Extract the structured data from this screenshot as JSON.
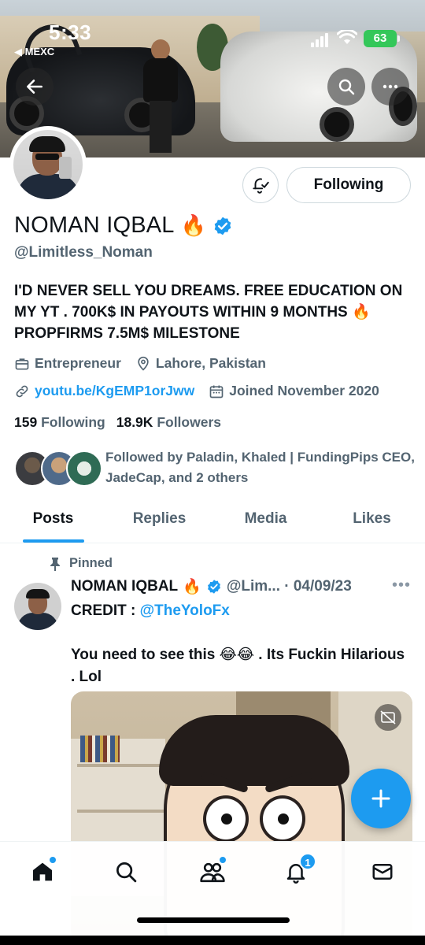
{
  "status_bar": {
    "time": "5:33",
    "back_app": "◀ MEXC",
    "battery": "63"
  },
  "header": {
    "back_icon": "back-arrow-icon",
    "search_icon": "search-icon",
    "more_icon": "more-horizontal-icon"
  },
  "profile": {
    "name": "NOMAN IQBAL",
    "name_emoji": "🔥",
    "verified": true,
    "handle": "@Limitless_Noman",
    "bio": "I'D NEVER SELL YOU DREAMS. FREE EDUCATION ON MY YT . 700K$ IN PAYOUTS WITHIN 9 MONTHS 🔥 PROPFIRMS 7.5M$ MILESTONE",
    "category": "Entrepreneur",
    "location": "Lahore, Pakistan",
    "link": "youtu.be/KgEMP1orJww",
    "joined": "Joined November 2020",
    "following_count": "159",
    "following_label": "Following",
    "followers_count": "18.9K",
    "followers_label": "Followers",
    "followed_by": "Followed by Paladin, Khaled | FundingPips CEO, JadeCap, and 2 others"
  },
  "actions": {
    "follow_label": "Following"
  },
  "tabs": [
    {
      "label": "Posts",
      "active": true
    },
    {
      "label": "Replies",
      "active": false
    },
    {
      "label": "Media",
      "active": false
    },
    {
      "label": "Likes",
      "active": false
    }
  ],
  "post": {
    "pinned_label": "Pinned",
    "author": "NOMAN IQBAL",
    "author_emoji": "🔥",
    "handle_date": "@Lim... · 04/09/23",
    "credit_prefix": "CREDIT : ",
    "credit_mention": "@TheYoloFx",
    "text": "You need to see this 😂😂 . Its Fuckin Hilarious .  Lol"
  },
  "nav": {
    "notifications_badge": "1"
  },
  "colors": {
    "accent": "#1d9bf0",
    "text_primary": "#0f1419",
    "text_secondary": "#536471",
    "battery": "#34c759"
  }
}
